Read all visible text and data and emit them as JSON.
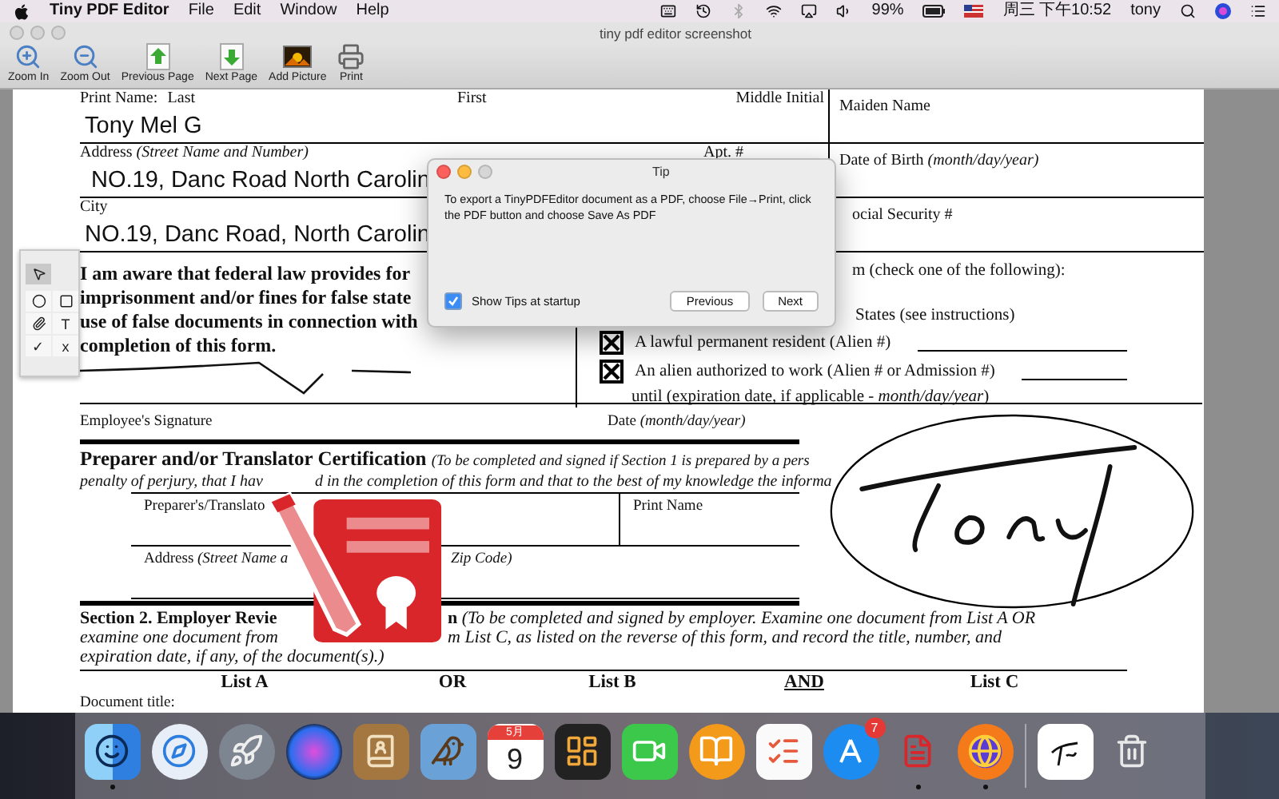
{
  "menu_bar": {
    "app_name": "Tiny PDF Editor",
    "menus": [
      "File",
      "Edit",
      "Window",
      "Help"
    ],
    "battery": "99%",
    "clock": "周三 下午10:52",
    "user": "tony"
  },
  "window": {
    "title": "tiny pdf editor screenshot"
  },
  "toolbar": [
    {
      "kind": "zoom-in",
      "label": "Zoom In"
    },
    {
      "kind": "zoom-out",
      "label": "Zoom Out"
    },
    {
      "kind": "previous",
      "label": "Previous Page"
    },
    {
      "kind": "next",
      "label": "Next Page"
    },
    {
      "kind": "picture",
      "label": "Add Picture"
    },
    {
      "kind": "print",
      "label": "Print"
    }
  ],
  "form": {
    "name_labels": [
      "Print Name:",
      "Last",
      "First",
      "Middle Initial"
    ],
    "maiden_label": "Maiden Name",
    "name_value": "Tony Mel G",
    "address_label": "Address *(Street Name and Number)*",
    "apt_label": "Apt. #",
    "dob_label": "Date of Birth *(month/day/year)*",
    "address_value": "NO.19, Danc Road North Carolin",
    "city_label": "City",
    "ssn_label": "ocial Security #",
    "city_value": "NO.19, Danc Road, North Carolin",
    "attestation": [
      "I am aware that federal law provides for",
      "imprisonment and/or fines for false state",
      "use of false documents in connection with",
      "completion of this form."
    ],
    "status_intro": "m (check one of the following):",
    "status_first": "States (see instructions)",
    "status_options": [
      {
        "label": "A lawful permanent resident (Alien #)",
        "checked": true
      },
      {
        "label": "An alien authorized to work (Alien # or Admission #)",
        "checked": true
      }
    ],
    "expiration": "until (expiration date, if applicable - *month/day/year*)",
    "employee_signature": "Employee's Signature",
    "date_label": "Date *(month/day/year)*",
    "preparer_heading": "Preparer and/or Translator Certification",
    "preparer_note": "(To be completed and signed if Section 1 is prepared by a pers",
    "penalty_parts": [
      "penalty of perjury, that I hav",
      "d in the completion of this form and that to the best of my knowledge the informa"
    ],
    "preparer_signature": "Preparer's/Translato",
    "print_name": "Print Name",
    "preparer_address_parts": [
      "Address *(Street Name a*",
      "*Zip Code)*"
    ],
    "section2_line1": [
      "**Section 2. Employer Revie**",
      "**n** *(To be completed and signed by employer. Examine one document from List A OR*"
    ],
    "section2_line2": [
      "examine one document from",
      "m List C, as listed on the reverse of this form, and record the title, number, and"
    ],
    "section2_line3": "expiration date, if any, of the document(s).)",
    "lists": [
      {
        "label": "List A",
        "underlined": false
      },
      {
        "label": "OR",
        "underlined": false
      },
      {
        "label": "List B",
        "underlined": false
      },
      {
        "label": "AND",
        "underlined": true
      },
      {
        "label": "List C",
        "underlined": false
      }
    ],
    "document_title": "Document title:"
  },
  "tool_palette": [
    {
      "kind": "arrow",
      "selected": true
    },
    {
      "kind": "circle",
      "selected": false
    },
    {
      "kind": "square",
      "selected": false
    },
    {
      "kind": "pen",
      "selected": false
    },
    {
      "kind": "text",
      "label": "T",
      "selected": false
    },
    {
      "kind": "text",
      "label": "✓",
      "selected": false
    },
    {
      "kind": "text",
      "label": "x",
      "selected": false
    }
  ],
  "tip_dialog": {
    "title": "Tip",
    "message": "To export a TinyPDFEditor document as a PDF, choose File→Print, click the PDF button and choose Save As PDF",
    "show_tips": {
      "label": "Show Tips at startup",
      "checked": true
    },
    "buttons": [
      "Previous",
      "Next"
    ]
  },
  "dock": [
    {
      "kind": "finder",
      "running": true
    },
    {
      "kind": "safari",
      "running": false
    },
    {
      "kind": "launchpad",
      "running": false
    },
    {
      "kind": "siri",
      "running": false
    },
    {
      "kind": "contacts",
      "running": false
    },
    {
      "kind": "mail",
      "running": false
    },
    {
      "kind": "calendar",
      "month": "5月",
      "day": "9",
      "running": false
    },
    {
      "kind": "grid",
      "running": false
    },
    {
      "kind": "facetime",
      "running": false
    },
    {
      "kind": "books",
      "running": false
    },
    {
      "kind": "reminders",
      "running": false
    },
    {
      "kind": "appstore",
      "badge": "7",
      "running": false
    },
    {
      "kind": "pdf",
      "running": true
    },
    {
      "kind": "firefox",
      "running": true
    },
    {
      "kind": "separator"
    },
    {
      "kind": "document",
      "running": false
    },
    {
      "kind": "trash",
      "running": false
    }
  ]
}
